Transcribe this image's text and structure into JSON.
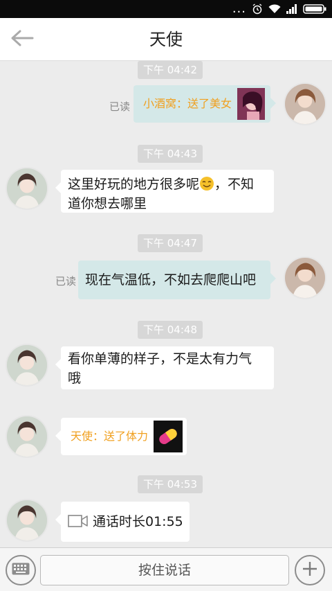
{
  "status_bar": {
    "dots": "...",
    "icons": [
      "alarm-icon",
      "wifi-icon",
      "signal-icon",
      "battery-icon"
    ]
  },
  "header": {
    "back_icon": "arrow-left-icon",
    "title": "天使"
  },
  "messages": [
    {
      "type": "timestamp",
      "text": "下午 04:42"
    },
    {
      "type": "gift",
      "side": "right",
      "read": "已读",
      "text": "小酒窝：送了美女",
      "gift_icon": "girl-photo-gift"
    },
    {
      "type": "timestamp",
      "text": "下午 04:43"
    },
    {
      "type": "text",
      "side": "left",
      "line1": "这里好玩的地方很多呢",
      "emoji": "smile-emoji",
      "line1b": "，不知",
      "line2": "道你想去哪里"
    },
    {
      "type": "timestamp",
      "text": "下午 04:47"
    },
    {
      "type": "text",
      "side": "right",
      "read": "已读",
      "line1": "现在气温低，不如去爬爬山吧"
    },
    {
      "type": "timestamp",
      "text": "下午 04:48"
    },
    {
      "type": "text",
      "side": "left",
      "line1": "看你单薄的样子，不是太有力气",
      "line2": "哦"
    },
    {
      "type": "gift",
      "side": "left",
      "text": "天使：送了体力",
      "gift_icon": "capsule-pill-icon"
    },
    {
      "type": "timestamp",
      "text": "下午 04:53"
    },
    {
      "type": "call",
      "side": "left",
      "text": "通话时长01:55",
      "icon": "video-camera-icon"
    }
  ],
  "input_bar": {
    "keyboard_icon": "keyboard-icon",
    "hold_to_talk": "按住说话",
    "plus_icon": "plus-icon"
  },
  "colors": {
    "gift_text": "#f0a020",
    "right_bubble": "#d4e8e8",
    "left_bubble": "#ffffff",
    "timestamp_bg": "#d7d7d7"
  }
}
